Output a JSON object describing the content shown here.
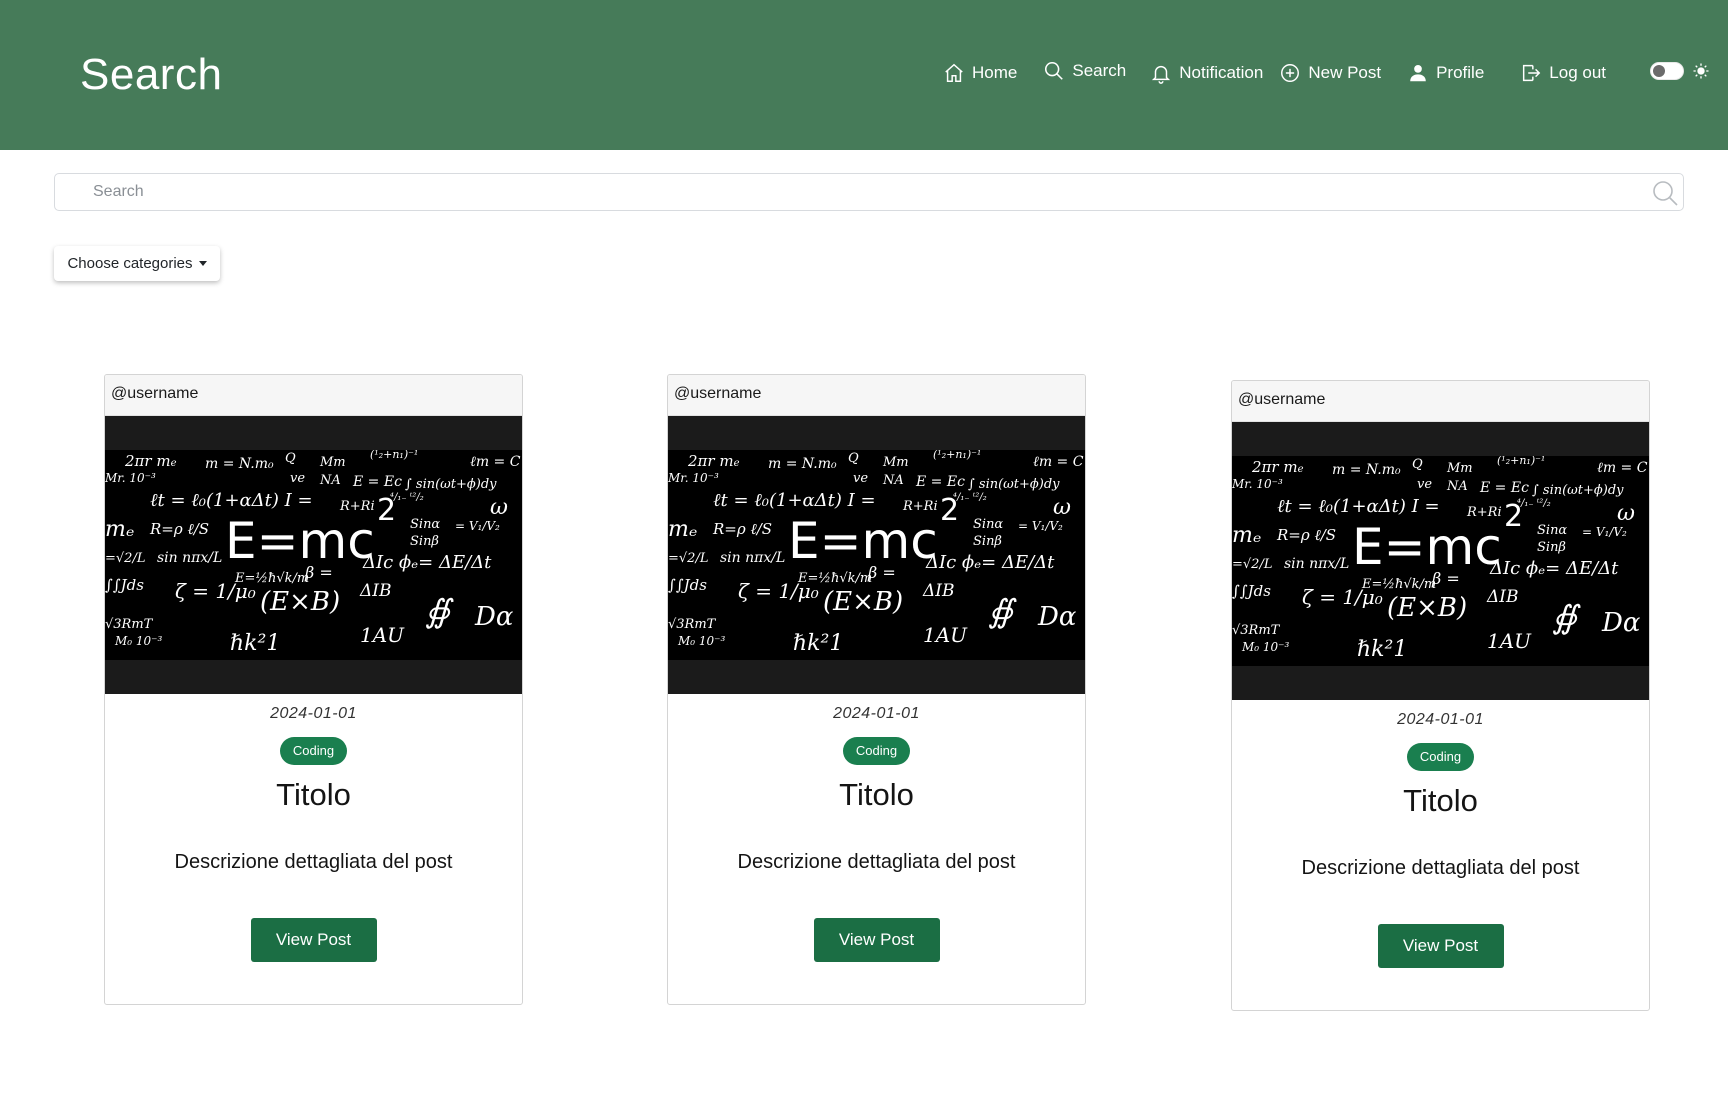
{
  "header": {
    "title": "Search",
    "nav": [
      {
        "label": "Home",
        "icon": "home-icon"
      },
      {
        "label": "Search",
        "icon": "search-icon"
      },
      {
        "label": "Notification",
        "icon": "bell-icon"
      },
      {
        "label": "New Post",
        "icon": "plus-circle-icon"
      },
      {
        "label": "Profile",
        "icon": "person-icon"
      },
      {
        "label": "Log out",
        "icon": "logout-icon"
      }
    ],
    "theme_icon": "sun-icon",
    "bg_color": "#467b59"
  },
  "search": {
    "placeholder": "Search",
    "value": ""
  },
  "filters": {
    "categories_label": "Choose categories"
  },
  "posts": [
    {
      "username": "@username",
      "date": "2024-01-01",
      "category": "Coding",
      "title": "Titolo",
      "description": "Descrizione dettagliata del post",
      "button_label": "View Post"
    },
    {
      "username": "@username",
      "date": "2024-01-01",
      "category": "Coding",
      "title": "Titolo",
      "description": "Descrizione dettagliata del post",
      "button_label": "View Post"
    },
    {
      "username": "@username",
      "date": "2024-01-01",
      "category": "Coding",
      "title": "Titolo",
      "description": "Descrizione dettagliata del post",
      "button_label": "View Post"
    }
  ],
  "colors": {
    "accent": "#1b6e44",
    "badge": "#1a7f4f"
  }
}
